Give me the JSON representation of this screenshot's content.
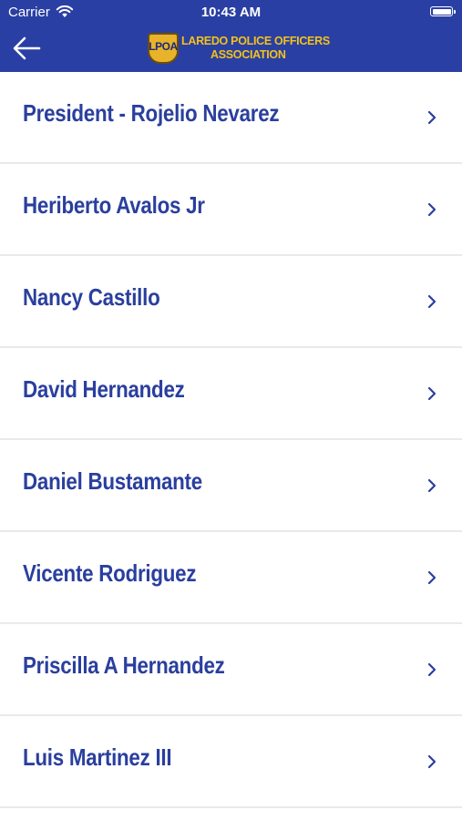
{
  "status_bar": {
    "carrier": "Carrier",
    "time": "10:43 AM"
  },
  "header": {
    "back_icon": "arrow-left-icon",
    "logo": {
      "badge_text": "LPOA",
      "line1": "LAREDO POLICE OFFICERS",
      "line2": "ASSOCIATION"
    }
  },
  "colors": {
    "header_bg": "#2a3fa3",
    "accent_gold": "#f2c21b",
    "item_text": "#2a3f9e"
  },
  "members": [
    {
      "label": "President - Rojelio Nevarez"
    },
    {
      "label": "Heriberto Avalos Jr"
    },
    {
      "label": "Nancy Castillo"
    },
    {
      "label": "David Hernandez"
    },
    {
      "label": "Daniel Bustamante"
    },
    {
      "label": "Vicente Rodriguez"
    },
    {
      "label": "Priscilla A Hernandez"
    },
    {
      "label": "Luis Martinez III"
    }
  ]
}
